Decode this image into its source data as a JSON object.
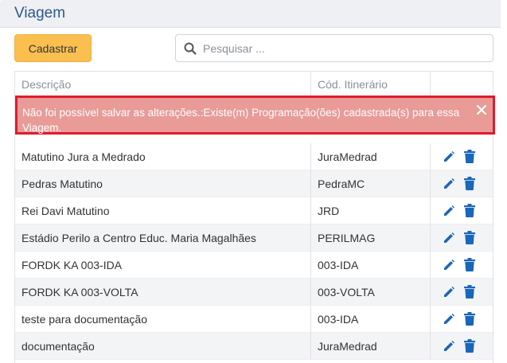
{
  "header": {
    "title": "Viagem"
  },
  "toolbar": {
    "add_label": "Cadastrar",
    "search_placeholder": "Pesquisar ...",
    "search_value": ""
  },
  "table": {
    "columns": [
      "Descrição",
      "Cód. Itinerário",
      ""
    ],
    "alert": "Não foi possível salvar as alterações.:Existe(m) Programação(ões) cadastrada(s) para essa Viagem.",
    "rows": [
      {
        "descricao": "Matutino Jura a Medrado",
        "codigo": "JuraMedrad"
      },
      {
        "descricao": "Pedras Matutino",
        "codigo": "PedraMC"
      },
      {
        "descricao": "Rei Davi Matutino",
        "codigo": "JRD"
      },
      {
        "descricao": "Estádio Perilo a Centro Educ. Maria Magalhães",
        "codigo": "PERILMAG"
      },
      {
        "descricao": "FORDK KA 003-IDA",
        "codigo": "003-IDA"
      },
      {
        "descricao": "FORDK KA 003-VOLTA",
        "codigo": "003-VOLTA"
      },
      {
        "descricao": "teste para documentação",
        "codigo": "003-IDA"
      },
      {
        "descricao": "documentação",
        "codigo": "JuraMedrad"
      }
    ]
  },
  "icons": {
    "search": "search-icon",
    "close": "close-icon",
    "edit": "pencil-icon",
    "delete": "trash-icon"
  },
  "colors": {
    "title": "#2e5a88",
    "primary_button": "#fbbf4f",
    "alert_bg": "#e89b97",
    "alert_border": "#e01b2d",
    "action_icons": "#1a66b8"
  }
}
